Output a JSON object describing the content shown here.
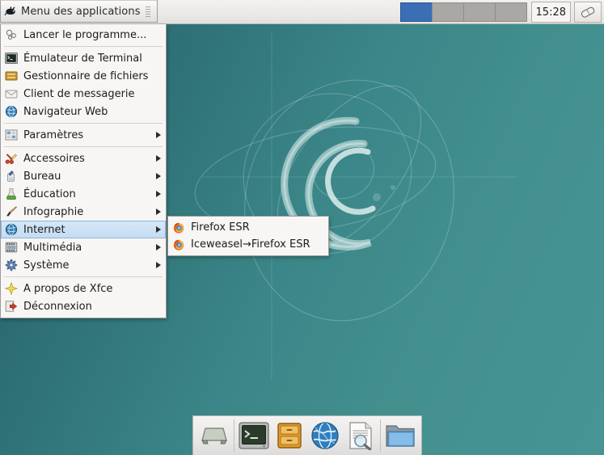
{
  "desktop": {
    "wallpaper_name": "debian-swirl-wallpaper",
    "background_color": "#3b8688",
    "background_color_dark": "#1f565f"
  },
  "panel": {
    "applications_button": {
      "label": "Menu des applications",
      "icon": "xfce-mouse-icon"
    },
    "workspaces": [
      {
        "name": "workspace-1",
        "active": true
      },
      {
        "name": "workspace-2",
        "active": false
      },
      {
        "name": "workspace-3",
        "active": false
      },
      {
        "name": "workspace-4",
        "active": false
      }
    ],
    "clock": "15:28",
    "tray_action_icon": "eraser-icon"
  },
  "app_menu": {
    "groups": [
      {
        "items": [
          {
            "label": "Lancer le programme...",
            "icon": "run-program-icon",
            "submenu": false
          }
        ]
      },
      {
        "items": [
          {
            "label": "Émulateur de Terminal",
            "icon": "terminal-icon",
            "submenu": false
          },
          {
            "label": "Gestionnaire de fichiers",
            "icon": "file-manager-icon",
            "submenu": false
          },
          {
            "label": "Client de messagerie",
            "icon": "mail-client-icon",
            "submenu": false
          },
          {
            "label": "Navigateur Web",
            "icon": "web-browser-icon",
            "submenu": false
          }
        ]
      },
      {
        "items": [
          {
            "label": "Paramètres",
            "icon": "settings-icon",
            "submenu": true
          }
        ]
      },
      {
        "items": [
          {
            "label": "Accessoires",
            "icon": "accessories-icon",
            "submenu": true
          },
          {
            "label": "Bureau",
            "icon": "office-icon",
            "submenu": true
          },
          {
            "label": "Éducation",
            "icon": "education-icon",
            "submenu": true
          },
          {
            "label": "Infographie",
            "icon": "graphics-icon",
            "submenu": true
          },
          {
            "label": "Internet",
            "icon": "internet-globe-icon",
            "submenu": true,
            "selected": true
          },
          {
            "label": "Multimédia",
            "icon": "multimedia-icon",
            "submenu": true
          },
          {
            "label": "Système",
            "icon": "system-gear-icon",
            "submenu": true
          }
        ]
      },
      {
        "items": [
          {
            "label": "A propos de Xfce",
            "icon": "about-xfce-icon",
            "submenu": false
          },
          {
            "label": "Déconnexion",
            "icon": "logout-icon",
            "submenu": false
          }
        ]
      }
    ]
  },
  "sub_menu": {
    "parent": "Internet",
    "items": [
      {
        "label": "Firefox ESR",
        "icon": "firefox-icon"
      },
      {
        "label": "Iceweasel→Firefox ESR",
        "icon": "firefox-icon"
      }
    ]
  },
  "dock": {
    "items": [
      {
        "name": "show-desktop",
        "icon": "show-desktop-icon"
      },
      {
        "separator_after": true
      },
      {
        "name": "terminal",
        "icon": "terminal-icon"
      },
      {
        "name": "file-manager",
        "icon": "file-cabinet-icon"
      },
      {
        "name": "web-browser",
        "icon": "globe-icon"
      },
      {
        "name": "document-viewer",
        "icon": "document-magnifier-icon"
      },
      {
        "separator_after": true
      },
      {
        "name": "file-browser",
        "icon": "folder-icon"
      }
    ]
  }
}
